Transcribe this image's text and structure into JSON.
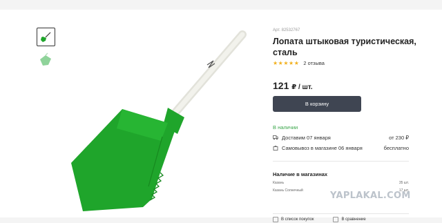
{
  "product": {
    "article": "Арт. 82532767",
    "title": "Лопата штыковая туристическая, сталь",
    "rating_stars": "★★★★★",
    "rating_value": 4.5,
    "reviews": "2 отзыва",
    "price": "121",
    "price_unit": "₽ / шт.",
    "cart_button": "В корзину",
    "stock_status": "В наличии"
  },
  "delivery": [
    {
      "icon": "truck-icon",
      "label": "Доставим 07 января",
      "value": "от 230 ₽"
    },
    {
      "icon": "bag-icon",
      "label": "Самовывоз в магазине 06 января",
      "value": "бесплатно"
    }
  ],
  "stores": {
    "title": "Наличие в магазинах",
    "items": [
      {
        "name": "Казань",
        "qty": "35 шт."
      },
      {
        "name": "Казань Солнечный",
        "qty": "17 шт."
      }
    ]
  },
  "actions": {
    "wishlist": "В список покупок",
    "compare": "В сравнение"
  },
  "watermark": "YAPLAKAL.COM",
  "colors": {
    "accent_button": "#3f4552",
    "stock_green": "#3aa64a",
    "star": "#f2b01e",
    "shovel_green": "#1fa52b"
  }
}
